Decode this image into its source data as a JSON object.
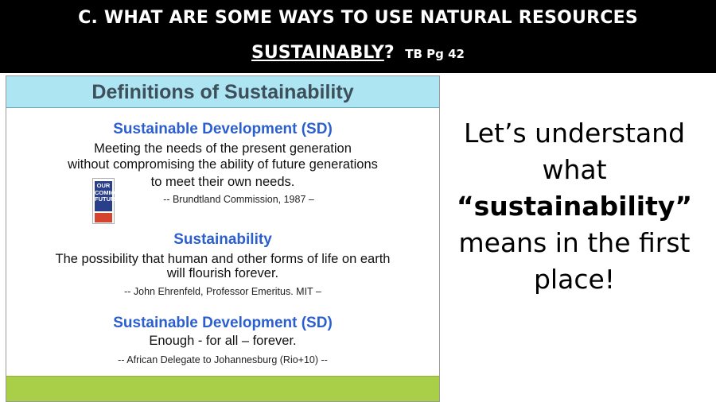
{
  "title": {
    "line1": "C. WHAT ARE SOME WAYS TO USE NATURAL RESOURCES",
    "line2_underlined": "SUSTAINABLY",
    "line2_mark": "?",
    "line2_ref": "TB Pg 42"
  },
  "slide": {
    "header": "Definitions of Sustainability",
    "def1": {
      "heading": "Sustainable Development (SD)",
      "lines": [
        "Meeting the needs of the present generation",
        "without compromising the ability of future generations",
        "to meet their own needs."
      ],
      "citation": "-- Brundtland Commission, 1987 –"
    },
    "book": {
      "title": "OUR COMMON FUTURE"
    },
    "def2": {
      "heading": "Sustainability",
      "lines": [
        "The possibility that human and other forms of life on earth",
        "will flourish forever."
      ],
      "citation": "-- John Ehrenfeld, Professor Emeritus. MIT –"
    },
    "def3": {
      "heading": "Sustainable Development (SD)",
      "lines": [
        "Enough - for all – forever."
      ],
      "citation": "-- African Delegate to Johannesburg (Rio+10) --"
    },
    "colors": {
      "header_bg": "#aee5f2",
      "footer_bg": "#a9cf49",
      "heading_blue": "#2b5fcf"
    }
  },
  "side": {
    "line1": "Let’s understand",
    "line2": "what",
    "line3": "“sustainability”",
    "line4": "means in the first",
    "line5": "place!"
  }
}
